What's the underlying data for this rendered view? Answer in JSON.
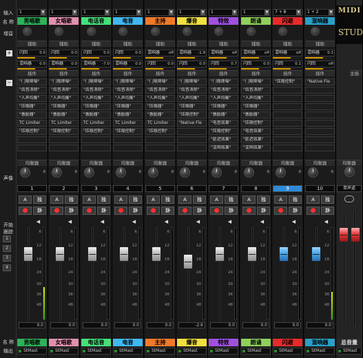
{
  "left_panel": {
    "input_label": "输入",
    "name_label": "名 称",
    "gain_label": "增益",
    "pan_label": "声像",
    "labels_1": "开始",
    "labels_2": "跟踪",
    "side_buttons": [
      "1",
      "2",
      "3",
      "4"
    ],
    "bottom_name_label": "名 称",
    "output_label": "输出"
  },
  "section_labels": {
    "aux": "辅助",
    "insert": "插件",
    "eq": "均衡器",
    "main": "主插"
  },
  "branding": {
    "midi": "MIDI",
    "studio": "STUD"
  },
  "channels": [
    {
      "num": "1",
      "input": "1",
      "name": "男唱歌",
      "color": "#2db35a",
      "sends": [
        {
          "label": "闪回",
          "value": "0.0"
        },
        {
          "label": "混响器",
          "value": "0.0"
        }
      ],
      "inserts": [
        "\"门限降噪\"",
        "\"齿音消除\"",
        "\"人声均衡\"",
        "\"压缩器\"",
        "\"激励器\"",
        "TC Limiter",
        "\"压限控制\"",
        "",
        ""
      ],
      "eq_label": "均衡器",
      "pan_value": "0",
      "fader_value": "0.0",
      "out": "StMast",
      "fader_pos": 0.28,
      "fader_color": "grey",
      "meter_level": 0.35,
      "selected": false
    },
    {
      "num": "2",
      "input": "1",
      "name": "女唱歌",
      "color": "#e38fb0",
      "sends": [
        {
          "label": "闪回",
          "value": "0.0"
        },
        {
          "label": "混响器",
          "value": "0.0"
        }
      ],
      "inserts": [
        "\"门限降噪\"",
        "\"齿音消除\"",
        "\"人声均衡\"",
        "\"压缩器\"",
        "\"激励器\"",
        "TC Limiter",
        "\"压限控制\"",
        "",
        ""
      ],
      "eq_label": "均衡器",
      "pan_value": "0",
      "fader_value": "0.0",
      "out": "StMast",
      "fader_pos": 0.28,
      "fader_color": "grey",
      "meter_level": 0,
      "selected": false
    },
    {
      "num": "3",
      "input": "1",
      "name": "电话音",
      "color": "#44e07a",
      "sends": [
        {
          "label": "闪回",
          "value": "0.0"
        },
        {
          "label": "混响器",
          "value": "-7.0"
        }
      ],
      "inserts": [
        "\"门限降噪\"",
        "\"齿音消除\"",
        "\"人声均衡\"",
        "\"压缩器\"",
        "\"激励器\"",
        "TC Limiter",
        "\"压限控制\"",
        "",
        ""
      ],
      "eq_label": "均衡器",
      "pan_value": "0",
      "fader_value": "0.0",
      "out": "StMast",
      "fader_pos": 0.28,
      "fader_color": "grey",
      "meter_level": 0,
      "selected": false
    },
    {
      "num": "4",
      "input": "1",
      "name": "电音",
      "color": "#3fb8f0",
      "sends": [
        {
          "label": "闪回",
          "value": "0.0"
        },
        {
          "label": "混响器",
          "value": "0.0"
        }
      ],
      "inserts": [
        "\"门限降噪\"",
        "\"齿音消除\"",
        "\"人声均衡\"",
        "\"压缩器\"",
        "\"激励器\"",
        "TC Limiter",
        "\"压限控制\"",
        "",
        ""
      ],
      "eq_label": "均衡器",
      "pan_value": "0",
      "fader_value": "0.0",
      "out": "StMast",
      "fader_pos": 0.28,
      "fader_color": "grey",
      "meter_level": 0,
      "selected": false
    },
    {
      "num": "5",
      "input": "1",
      "name": "主持",
      "color": "#f07a2a",
      "sends": [
        {
          "label": "混响器",
          "value": "off"
        },
        {
          "label": "闪回",
          "value": "0.0"
        }
      ],
      "inserts": [
        "\"门限降噪\"",
        "\"齿音消除\"",
        "\"人声均衡\"",
        "\"压缩器\"",
        "\"激励器\"",
        "TC Limiter",
        "\"压限控制\"",
        "",
        ""
      ],
      "eq_label": "均衡器",
      "pan_value": "0",
      "fader_value": "0.0",
      "out": "StMast",
      "fader_pos": 0.28,
      "fader_color": "grey",
      "meter_level": 0,
      "selected": false
    },
    {
      "num": "6",
      "input": "1",
      "name": "爆音",
      "color": "#f0e040",
      "sends": [
        {
          "label": "混响器",
          "value": "-1.9"
        },
        {
          "label": "闪回",
          "value": "0.0"
        }
      ],
      "inserts": [
        "\"门限降噪\"",
        "\"齿音消除\"",
        "\"人声均衡\"",
        "\"压缩器\"",
        "\"压限控制\"",
        "\"Native Fle",
        "",
        "",
        ""
      ],
      "eq_label": "均衡器",
      "pan_value": "0",
      "fader_value": "-2.6",
      "out": "StMast",
      "fader_pos": 0.36,
      "fader_color": "grey",
      "meter_level": 0,
      "selected": false
    },
    {
      "num": "7",
      "input": "1",
      "name": "特效",
      "color": "#a050e0",
      "sends": [
        {
          "label": "混响器",
          "value": "off"
        },
        {
          "label": "闪回",
          "value": "0.7"
        }
      ],
      "inserts": [
        "\"门限降噪\"",
        "\"齿音消除\"",
        "\"人声均衡\"",
        "\"压缩器\"",
        "\"激励器\"",
        "\"电音效果\"",
        "\"压限控制\"",
        "\"延迟效果\"",
        "\"混响效果\""
      ],
      "eq_label": "均衡器",
      "pan_value": "0",
      "fader_value": "0.0",
      "out": "StMast",
      "fader_pos": 0.28,
      "fader_color": "grey",
      "meter_level": 0,
      "selected": false
    },
    {
      "num": "8",
      "input": "1",
      "name": "朗诵",
      "color": "#8fd05a",
      "sends": [
        {
          "label": "混响器",
          "value": "off"
        },
        {
          "label": "闪回",
          "value": "0.0"
        }
      ],
      "inserts": [
        "\"门限降噪\"",
        "\"齿音消除\"",
        "\"人声均衡\"",
        "\"压缩器\"",
        "\"激励器\"",
        "\"压限控制\"",
        "\"电音效果\"",
        "\"延迟效果\"",
        "\"混响效果\""
      ],
      "eq_label": "均衡器",
      "pan_value": "0",
      "fader_value": "0.0",
      "out": "StMast",
      "fader_pos": 0.28,
      "fader_color": "grey",
      "meter_level": 0,
      "selected": false
    },
    {
      "num": "9",
      "input": "7 + 8",
      "name": "闪避",
      "color": "#e82a2a",
      "sends": [
        {
          "label": "混响器",
          "value": "off"
        },
        {
          "label": "闪回",
          "value": "0.1"
        }
      ],
      "inserts": [
        "\"压限控制\"",
        "",
        "",
        "",
        "",
        "",
        "",
        "",
        ""
      ],
      "eq_label": "均衡器",
      "pan_value": "0",
      "fader_value": "0.0",
      "out": "StMast",
      "fader_pos": 0.28,
      "fader_color": "blue",
      "meter_level": 0,
      "selected": true
    },
    {
      "num": "10",
      "input": "1 + 2",
      "name": "混响器",
      "color": "#2aa0c8",
      "sends": [
        {
          "label": "混响器",
          "value": "0.1"
        },
        {
          "label": "闪回",
          "value": "off"
        }
      ],
      "inserts": [
        "\"Native Fle",
        "",
        "",
        "",
        "",
        "",
        "",
        "",
        ""
      ],
      "eq_label": "均衡器",
      "pan_value": "0",
      "fader_value": "0.0",
      "out": "StMast",
      "fader_pos": 0.28,
      "fader_color": "blue",
      "meter_level": 0.3,
      "selected": false
    }
  ],
  "master": {
    "label": "单声道",
    "name": "总音量",
    "out": "StMast",
    "pan_label": "均衡器",
    "fader_color": "red"
  },
  "scale": [
    "6",
    "12",
    "18",
    "24",
    "30",
    "36",
    "48",
    "∞"
  ],
  "buttons": {
    "a": "A",
    "solo": "独",
    "rec": "●",
    "mute": "静"
  }
}
